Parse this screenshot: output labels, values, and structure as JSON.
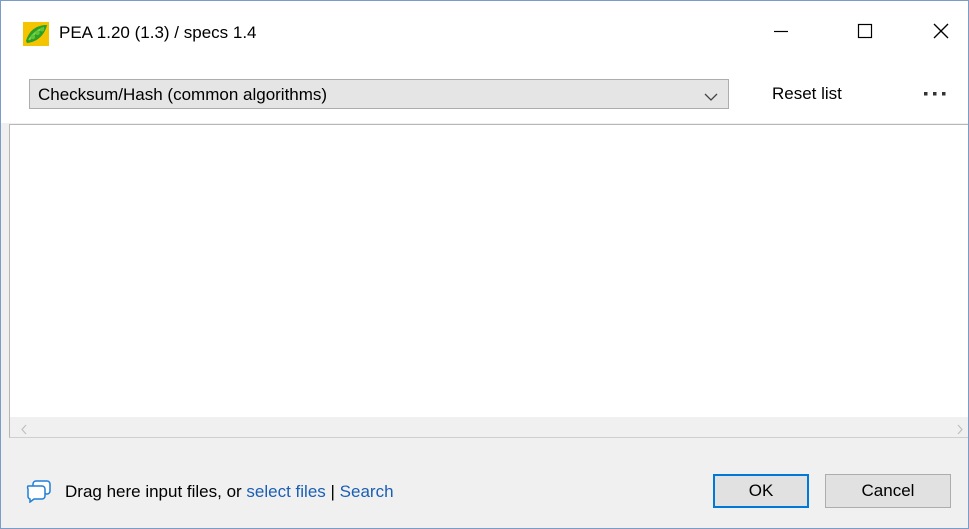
{
  "window": {
    "title": "PEA 1.20 (1.3) / specs 1.4",
    "icons": {
      "app": "pea-pod-icon",
      "minimize": "minimize-icon",
      "maximize": "maximize-icon",
      "close": "close-icon"
    }
  },
  "toolbar": {
    "profile_selected": "Checksum/Hash (common algorithms)",
    "reset_label": "Reset list",
    "more_icon": "ellipsis-icon"
  },
  "footer": {
    "icon": "chat-bubble-icon",
    "drag_text": "Drag here input files, or ",
    "select_link": "select files",
    "separator": " | ",
    "search_link": "Search",
    "ok_label": "OK",
    "cancel_label": "Cancel"
  },
  "colors": {
    "link": "#1a5fb4",
    "ok_border": "#0078d7",
    "window_border": "#7a9cc6"
  }
}
